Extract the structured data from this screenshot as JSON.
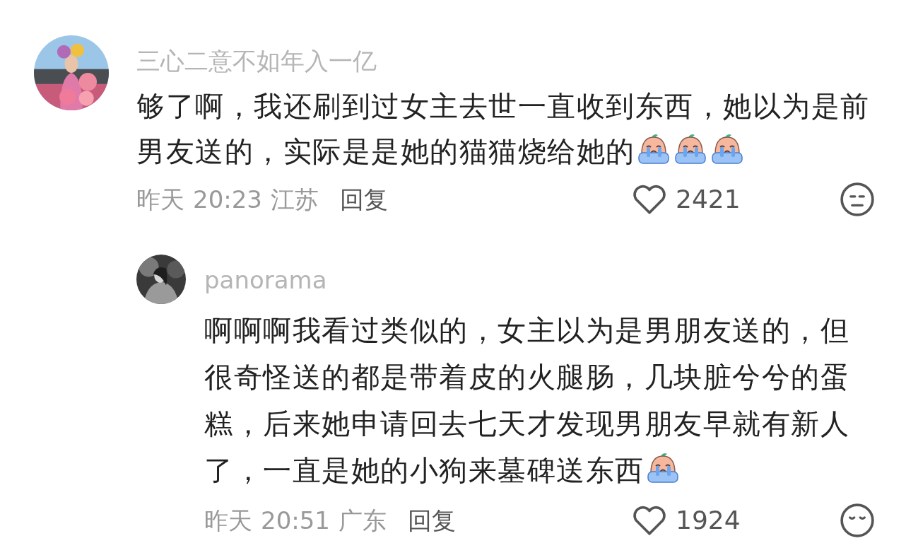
{
  "comments": [
    {
      "username": "三心二意不如年入一亿",
      "text": "够了啊，我还刷到过女主去世一直收到东西，她以为是前男友送的，实际是是她的猫猫烧给她的",
      "emojis": [
        {
          "kind": "crying"
        },
        {
          "kind": "crying"
        },
        {
          "kind": "crying"
        }
      ],
      "date": "昨天",
      "time": "20:23",
      "location": "江苏",
      "reply_label": "回复",
      "likes": "2421",
      "reaction": {
        "kind": "neutral"
      },
      "replies": [
        {
          "username": "panorama",
          "text": "啊啊啊我看过类似的，女主以为是男朋友送的，但很奇怪送的都是带着皮的火腿肠，几块脏兮兮的蛋糕，后来她申请回去七天才发现男朋友早就有新人了，一直是她的小狗来墓碑送东西",
          "emojis": [
            {
              "kind": "crying"
            }
          ],
          "date": "昨天",
          "time": "20:51",
          "location": "广东",
          "reply_label": "回复",
          "likes": "1924",
          "reaction": {
            "kind": "sleepy"
          }
        }
      ]
    }
  ]
}
